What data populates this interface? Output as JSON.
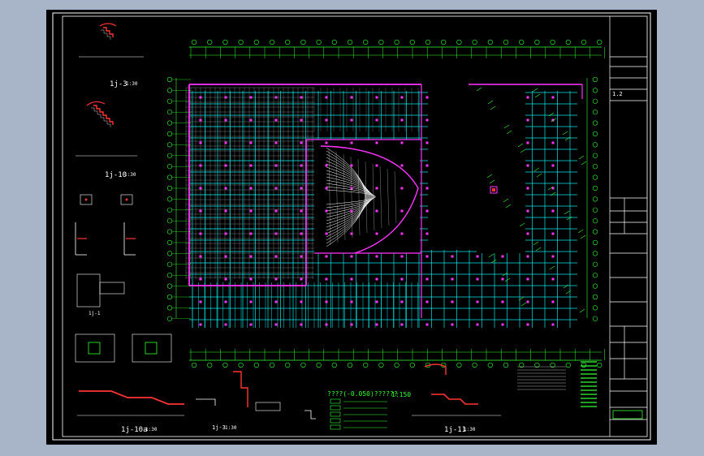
{
  "drawing": {
    "plan_title": "????(-0.050)??????",
    "plan_scale": "1:150",
    "section_labels": {
      "s1": "1j-3",
      "s2": "1j-10",
      "s3": "1j-10a",
      "s4": "1j-11",
      "s5": "1j-1",
      "s6": "1j-3"
    },
    "section_scale": "1:30",
    "title_block": {
      "rev": "1.2"
    }
  },
  "colors": {
    "background": "#000000",
    "frame": "#ffffff",
    "grid_axis": "#34ff34",
    "beam": "#00e5e5",
    "wall": "#ff33ff",
    "hatch": "#bbbbbb",
    "text": "#ffffff",
    "window_bg": "#a8b4c7"
  }
}
